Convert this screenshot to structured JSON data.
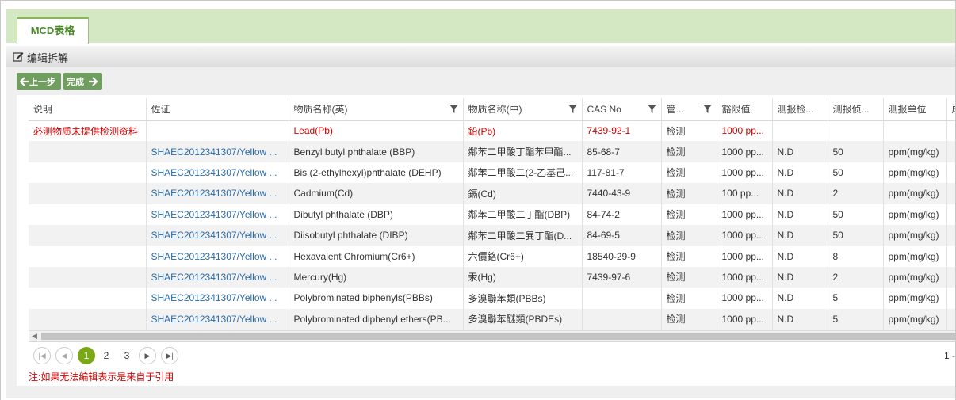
{
  "tab": {
    "label": "MCD表格"
  },
  "toolbar": {
    "edit_label": "编辑拆解"
  },
  "actions": {
    "prev_label": "上一步",
    "finish_label": "完成"
  },
  "columns": [
    "说明",
    "佐证",
    "物质名称(英)",
    "物质名称(中)",
    "CAS No",
    "管...",
    "豁限值",
    "测报检...",
    "测报侦...",
    "测报单位",
    "成"
  ],
  "rows": [
    [
      "必测物质未提供检测资料",
      "",
      "Lead(Pb)",
      "鉛(Pb)",
      "7439-92-1",
      "检测",
      "1000 pp...",
      "",
      "",
      "",
      ""
    ],
    [
      "",
      "SHAEC2012341307/Yellow ...",
      "Benzyl butyl phthalate (BBP)",
      "鄰苯二甲酸丁酯苯甲酯...",
      "85-68-7",
      "检测",
      "1000 pp...",
      "N.D",
      "50",
      "ppm(mg/kg)",
      ""
    ],
    [
      "",
      "SHAEC2012341307/Yellow ...",
      "Bis (2-ethylhexyl)phthalate (DEHP)",
      "鄰苯二甲酸二(2-乙基己...",
      "117-81-7",
      "检测",
      "1000 pp...",
      "N.D",
      "50",
      "ppm(mg/kg)",
      ""
    ],
    [
      "",
      "SHAEC2012341307/Yellow ...",
      "Cadmium(Cd)",
      "鎘(Cd)",
      "7440-43-9",
      "检测",
      "100 pp...",
      "N.D",
      "2",
      "ppm(mg/kg)",
      ""
    ],
    [
      "",
      "SHAEC2012341307/Yellow ...",
      "Dibutyl phthalate (DBP)",
      "鄰苯二甲酸二丁酯(DBP)",
      "84-74-2",
      "检测",
      "1000 pp...",
      "N.D",
      "50",
      "ppm(mg/kg)",
      ""
    ],
    [
      "",
      "SHAEC2012341307/Yellow ...",
      "Diisobutyl phthalate (DIBP)",
      "鄰苯二甲酸二異丁酯(D...",
      "84-69-5",
      "检测",
      "1000 pp...",
      "N.D",
      "50",
      "ppm(mg/kg)",
      ""
    ],
    [
      "",
      "SHAEC2012341307/Yellow ...",
      "Hexavalent Chromium(Cr6+)",
      "六價鉻(Cr6+)",
      "18540-29-9",
      "检测",
      "1000 pp...",
      "N.D",
      "8",
      "ppm(mg/kg)",
      ""
    ],
    [
      "",
      "SHAEC2012341307/Yellow ...",
      "Mercury(Hg)",
      "汞(Hg)",
      "7439-97-6",
      "检测",
      "1000 pp...",
      "N.D",
      "2",
      "ppm(mg/kg)",
      ""
    ],
    [
      "",
      "SHAEC2012341307/Yellow ...",
      "Polybrominated biphenyls(PBBs)",
      "多溴聯苯類(PBBs)",
      "",
      "检测",
      "1000 pp...",
      "N.D",
      "5",
      "ppm(mg/kg)",
      ""
    ],
    [
      "",
      "SHAEC2012341307/Yellow ...",
      "Polybrominated diphenyl ethers(PB...",
      "多溴聯苯醚類(PBDEs)",
      "",
      "检测",
      "1000 pp...",
      "N.D",
      "5",
      "ppm(mg/kg)",
      ""
    ]
  ],
  "pager": {
    "pages": [
      "1",
      "2",
      "3"
    ],
    "current": "1",
    "info": "1 -"
  },
  "note": "注:如果无法编辑表示是来自于引用",
  "colors": {
    "accent_green": "#7ba818",
    "tab_band": "#d4e8c4",
    "warning_red": "#d40000",
    "link_blue": "#2a6aa8"
  }
}
